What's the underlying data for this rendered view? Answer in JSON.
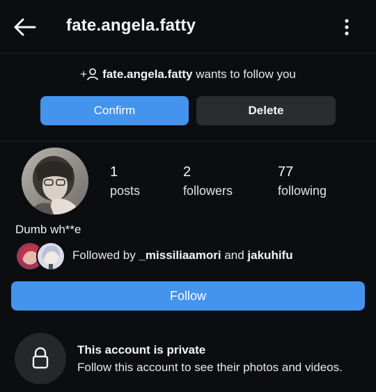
{
  "header": {
    "username": "fate.angela.fatty",
    "back_icon": "arrow-left-icon",
    "more_icon": "more-vertical-icon"
  },
  "follow_request": {
    "prefix": "+",
    "username": "fate.angela.fatty",
    "message": "wants to follow you",
    "confirm_label": "Confirm",
    "delete_label": "Delete"
  },
  "profile": {
    "stats": [
      {
        "value": "1",
        "label": "posts"
      },
      {
        "value": "2",
        "label": "followers"
      },
      {
        "value": "77",
        "label": "following"
      }
    ],
    "bio": "Dumb wh**e",
    "followed_by": {
      "prefix": "Followed by",
      "user1": "_missiliaamori",
      "connector": "and",
      "user2": "jakuhifu"
    },
    "follow_label": "Follow"
  },
  "private_notice": {
    "title": "This account is private",
    "subtitle": "Follow this account to see their photos and videos."
  },
  "colors": {
    "background": "#0c0d10",
    "primary_button": "#4493ec",
    "secondary_button": "#2b2c30"
  }
}
